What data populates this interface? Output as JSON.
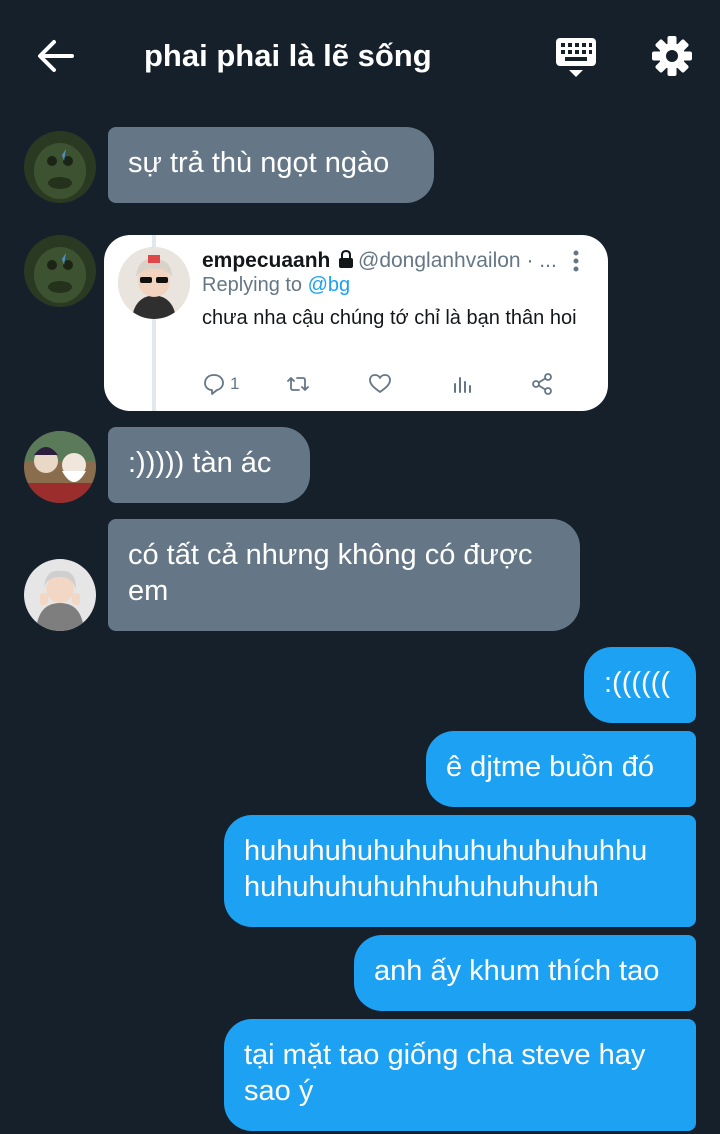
{
  "header": {
    "title": "phai phai là lẽ sống",
    "back_icon": "arrow-left-icon",
    "keyboard_icon": "keyboard-icon",
    "settings_icon": "gear-icon"
  },
  "messages": [
    {
      "text": "sự trả thù ngọt ngào"
    },
    {
      "text": ":))))) tàn ác"
    },
    {
      "text": "có tất cả nhưng không có được em"
    },
    {
      "text": ":(((((("
    },
    {
      "text": "ê djtme buồn đó"
    },
    {
      "text": "huhuhuhuhuhuhuhuhuhuhuhhu huhuhuhuhuhhuhuhuhuhuh"
    },
    {
      "text": "anh ấy khum thích tao"
    },
    {
      "text": "tại mặt tao giống cha steve hay sao ý"
    }
  ],
  "tweet": {
    "name": "empecuaanh",
    "handle": "@donglanhvailon · ...",
    "replying_prefix": "Replying to",
    "replying_to": "@bg",
    "text": "chưa nha cậu chúng tớ chỉ là bạn thân hoi",
    "reply_count": "1"
  },
  "colors": {
    "background": "#15202b",
    "incoming_bubble": "#657786",
    "outgoing_bubble": "#1da1f2"
  }
}
